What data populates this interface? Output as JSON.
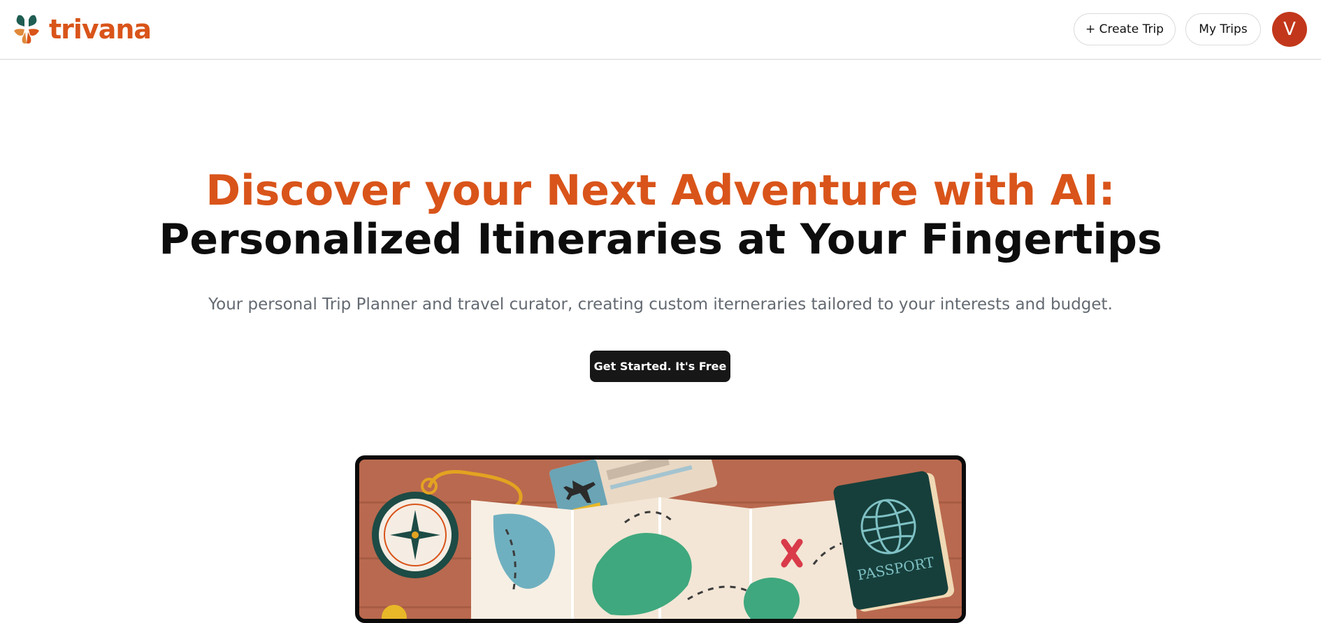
{
  "header": {
    "brand": "trivana",
    "create_trip_label": "+ Create Trip",
    "my_trips_label": "My Trips",
    "avatar_initial": "V"
  },
  "hero": {
    "headline_line1": "Discover your Next Adventure with AI:",
    "headline_line2": "Personalized Itineraries at Your Fingertips",
    "subtitle": "Your personal Trip Planner and travel curator, creating custom iterneraries tailored to your interests and budget.",
    "cta_label": "Get Started. It's Free"
  },
  "illustration": {
    "passport_text": "PASSPORT"
  },
  "colors": {
    "brand_orange": "#d9541a",
    "avatar_red": "#c2371b",
    "cta_dark": "#171717",
    "subtitle_gray": "#646a72"
  },
  "icons": [
    "logo-mark",
    "compass",
    "boarding-pass",
    "airplane",
    "treasure-map",
    "x-mark",
    "passport",
    "globe"
  ]
}
